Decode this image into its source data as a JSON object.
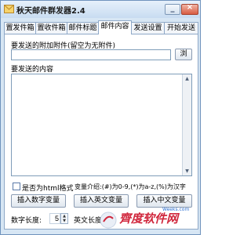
{
  "window": {
    "title": "秋天邮件群发器2.4"
  },
  "tabs": [
    {
      "label": "置发件箱",
      "active": false
    },
    {
      "label": "置收件箱",
      "active": false
    },
    {
      "label": "邮件标题",
      "active": false
    },
    {
      "label": "邮件内容",
      "active": true
    },
    {
      "label": "发送设置",
      "active": false
    },
    {
      "label": "开始发送",
      "active": false
    }
  ],
  "attachment": {
    "label": "要发送的附加附件(留空为无附件)",
    "value": "",
    "browse_label": "浏"
  },
  "content": {
    "label": "要发送的内容",
    "value": ""
  },
  "html_option": {
    "label": "是否为html格式",
    "checked": false
  },
  "variables": {
    "intro": "变量介绍:(#)为0-9,(*)为a-z,(%)为汉字",
    "insert_number_label": "插入数字变量",
    "insert_english_label": "插入英文变量",
    "insert_chinese_label": "插入中文变量"
  },
  "lengths": {
    "number_label": "数字长度:",
    "number_value": "5",
    "english_label": "英文长度:"
  },
  "watermark": {
    "text": "齊度软件网",
    "url": "Weeks.com"
  },
  "colors": {
    "window_bg": "#d7e6f4",
    "accent": "#6f93bd",
    "watermark_red": "#d0263c"
  }
}
